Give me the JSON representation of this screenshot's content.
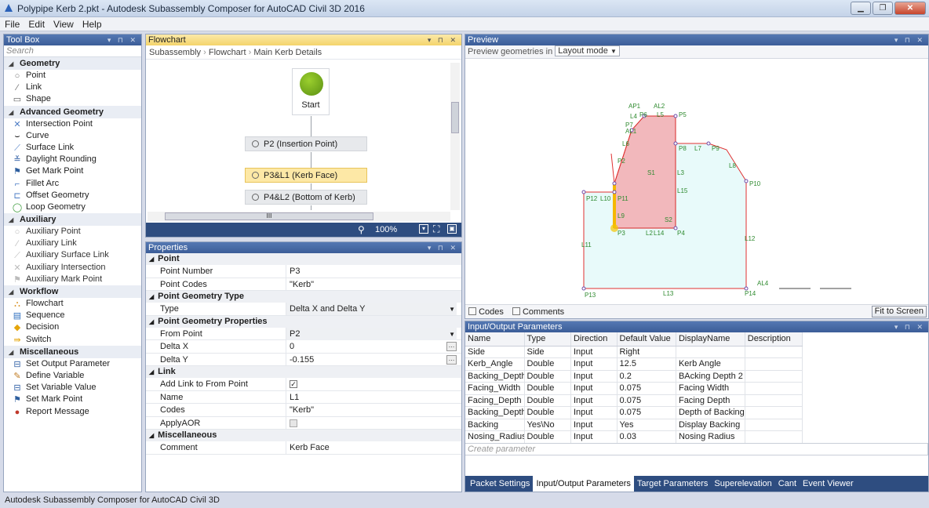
{
  "window": {
    "title": "Polypipe Kerb 2.pkt - Autodesk Subassembly Composer for AutoCAD Civil 3D 2016"
  },
  "menu": [
    "File",
    "Edit",
    "View",
    "Help"
  ],
  "toolbox": {
    "title": "Tool Box",
    "search_placeholder": "Search",
    "categories": [
      {
        "label": "Geometry",
        "items": [
          "Point",
          "Link",
          "Shape"
        ]
      },
      {
        "label": "Advanced Geometry",
        "items": [
          "Intersection Point",
          "Curve",
          "Surface Link",
          "Daylight Rounding",
          "Get Mark Point",
          "Fillet Arc",
          "Offset Geometry",
          "Loop Geometry"
        ]
      },
      {
        "label": "Auxiliary",
        "items": [
          "Auxiliary Point",
          "Auxiliary Link",
          "Auxiliary Surface Link",
          "Auxiliary Intersection",
          "Auxiliary Mark Point"
        ]
      },
      {
        "label": "Workflow",
        "items": [
          "Flowchart",
          "Sequence",
          "Decision",
          "Switch"
        ]
      },
      {
        "label": "Miscellaneous",
        "items": [
          "Set Output Parameter",
          "Define Variable",
          "Set Variable Value",
          "Set Mark Point",
          "Report Message"
        ]
      }
    ]
  },
  "flowchart": {
    "title": "Flowchart",
    "breadcrumb": [
      "Subassembly",
      "Flowchart",
      "Main Kerb Details"
    ],
    "start_label": "Start",
    "nodes": [
      "P2 (Insertion Point)",
      "P3&L1 (Kerb Face)",
      "P4&L2 (Bottom of Kerb)"
    ],
    "zoom": "100%",
    "scroll_mark": "III"
  },
  "properties": {
    "title": "Properties",
    "sections": {
      "point": "Point",
      "geom_type": "Point Geometry Type",
      "geom_props": "Point Geometry Properties",
      "link": "Link",
      "misc": "Miscellaneous"
    },
    "rows": {
      "point_number": {
        "key": "Point Number",
        "value": "P3"
      },
      "point_codes": {
        "key": "Point Codes",
        "value": "\"Kerb\""
      },
      "type": {
        "key": "Type",
        "value": "Delta X and Delta Y"
      },
      "from_point": {
        "key": "From Point",
        "value": "P2"
      },
      "delta_x": {
        "key": "Delta X",
        "value": "0"
      },
      "delta_y": {
        "key": "Delta Y",
        "value": "-0.155"
      },
      "add_link": {
        "key": "Add Link to From Point",
        "value": "✓"
      },
      "name": {
        "key": "Name",
        "value": "L1"
      },
      "codes": {
        "key": "Codes",
        "value": "\"Kerb\""
      },
      "apply_aor": {
        "key": "ApplyAOR",
        "value": ""
      },
      "comment": {
        "key": "Comment",
        "value": "Kerb Face"
      }
    }
  },
  "preview": {
    "title": "Preview",
    "mode_label": "Preview geometries in",
    "mode_value": "Layout mode",
    "codes_label": "Codes",
    "comments_label": "Comments",
    "fit_button": "Fit to Screen",
    "labels": [
      "AP1",
      "AL2",
      "L4",
      "P6",
      "L5",
      "P5",
      "P7",
      "AL1",
      "L6",
      "P8",
      "L7",
      "P9",
      "P2",
      "L8",
      "S1",
      "L3",
      "P10",
      "L15",
      "P12",
      "L10",
      "P11",
      "L9",
      "S2",
      "P3",
      "L2",
      "L14",
      "P4",
      "L12",
      "L11",
      "AL4",
      "P13",
      "L13",
      "P14"
    ]
  },
  "io": {
    "title": "Input/Output Parameters",
    "columns": [
      "Name",
      "Type",
      "Direction",
      "Default Value",
      "DisplayName",
      "Description"
    ],
    "rows": [
      [
        "Side",
        "Side",
        "Input",
        "Right",
        "",
        ""
      ],
      [
        "Kerb_Angle",
        "Double",
        "Input",
        "12.5",
        "Kerb Angle",
        ""
      ],
      [
        "Backing_Depth_Cc",
        "Double",
        "Input",
        "0.2",
        "BAcking Depth 2",
        ""
      ],
      [
        "Facing_Width",
        "Double",
        "Input",
        "0.075",
        "Facing Width",
        ""
      ],
      [
        "Facing_Depth",
        "Double",
        "Input",
        "0.075",
        "Facing Depth",
        ""
      ],
      [
        "Backing_Depth",
        "Double",
        "Input",
        "0.075",
        "Depth of Backing",
        ""
      ],
      [
        "Backing",
        "Yes\\No",
        "Input",
        "Yes",
        "Display Backing",
        ""
      ],
      [
        "Nosing_Radius",
        "Double",
        "Input",
        "0.03",
        "Nosing Radius",
        ""
      ]
    ],
    "create_placeholder": "Create parameter",
    "tabs": [
      "Packet Settings",
      "Input/Output Parameters",
      "Target Parameters",
      "Superelevation",
      "Cant",
      "Event Viewer"
    ],
    "active_tab": "Input/Output Parameters"
  },
  "status": "Autodesk Subassembly Composer for AutoCAD Civil 3D"
}
